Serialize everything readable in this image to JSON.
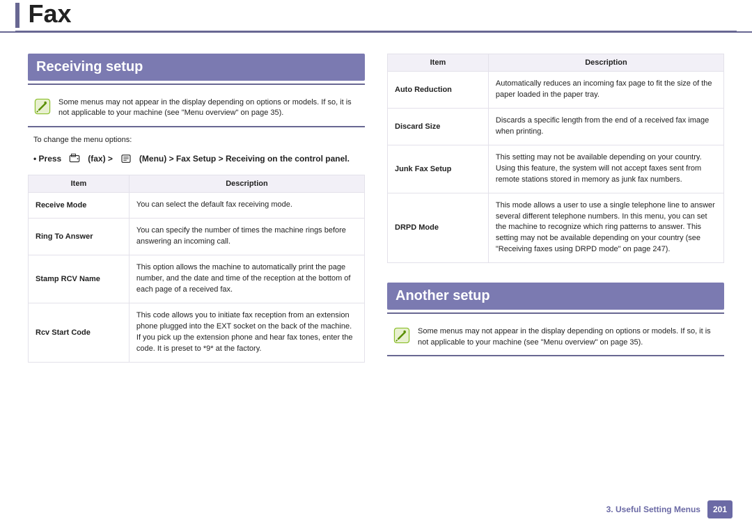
{
  "title": "Fax",
  "left": {
    "section_header": "Receiving setup",
    "note_text": "Some menus may not appear in the display depending on options or models. If so, it is not applicable to your machine (see \"Menu overview\" on page 35).",
    "instruction_text": "To change the menu options:",
    "menu_path_prefix": "• Press",
    "menu_path_main": "(Menu) > Fax Setup > Receiving on the control panel.",
    "table": {
      "head_item": "Item",
      "head_desc": "Description",
      "rows": [
        {
          "item": "Receive Mode",
          "desc": "You can select the default fax receiving mode."
        },
        {
          "item": "Ring To Answer",
          "desc": "You can specify the number of times the machine rings before answering an incoming call."
        },
        {
          "item": "Stamp RCV Name",
          "desc": "This option allows the machine to automatically print the page number, and the date and time of the reception at the bottom of each page of a received fax."
        },
        {
          "item": "Rcv Start Code",
          "desc": "This code allows you to initiate fax reception from an extension phone plugged into the EXT socket on the back of the machine. If you pick up the extension phone and hear fax tones, enter the code. It is preset to *9* at the factory."
        }
      ]
    }
  },
  "right": {
    "table": {
      "head_item": "Item",
      "head_desc": "Description",
      "rows": [
        {
          "item": "Auto Reduction",
          "desc": "Automatically reduces an incoming fax page to fit the size of the paper loaded in the paper tray."
        },
        {
          "item": "Discard Size",
          "desc": "Discards a specific length from the end of a received fax image when printing."
        },
        {
          "item": "Junk Fax Setup",
          "desc": "This setting may not be available depending on your country. Using this feature, the system will not accept faxes sent from remote stations stored in memory as junk fax numbers."
        },
        {
          "item": "DRPD Mode",
          "desc": "This mode allows a user to use a single telephone line to answer several different telephone numbers. In this menu, you can set the machine to recognize which ring patterns to answer. This setting may not be available depending on your country (see \"Receiving faxes using DRPD mode\" on page 247)."
        }
      ]
    },
    "section_header": "Another setup",
    "note_text": "Some menus may not appear in the display depending on options or models. If so, it is not applicable to your machine (see \"Menu overview\" on page 35)."
  },
  "footer": {
    "chapter": "3.  Useful Setting Menus",
    "page": "201"
  }
}
